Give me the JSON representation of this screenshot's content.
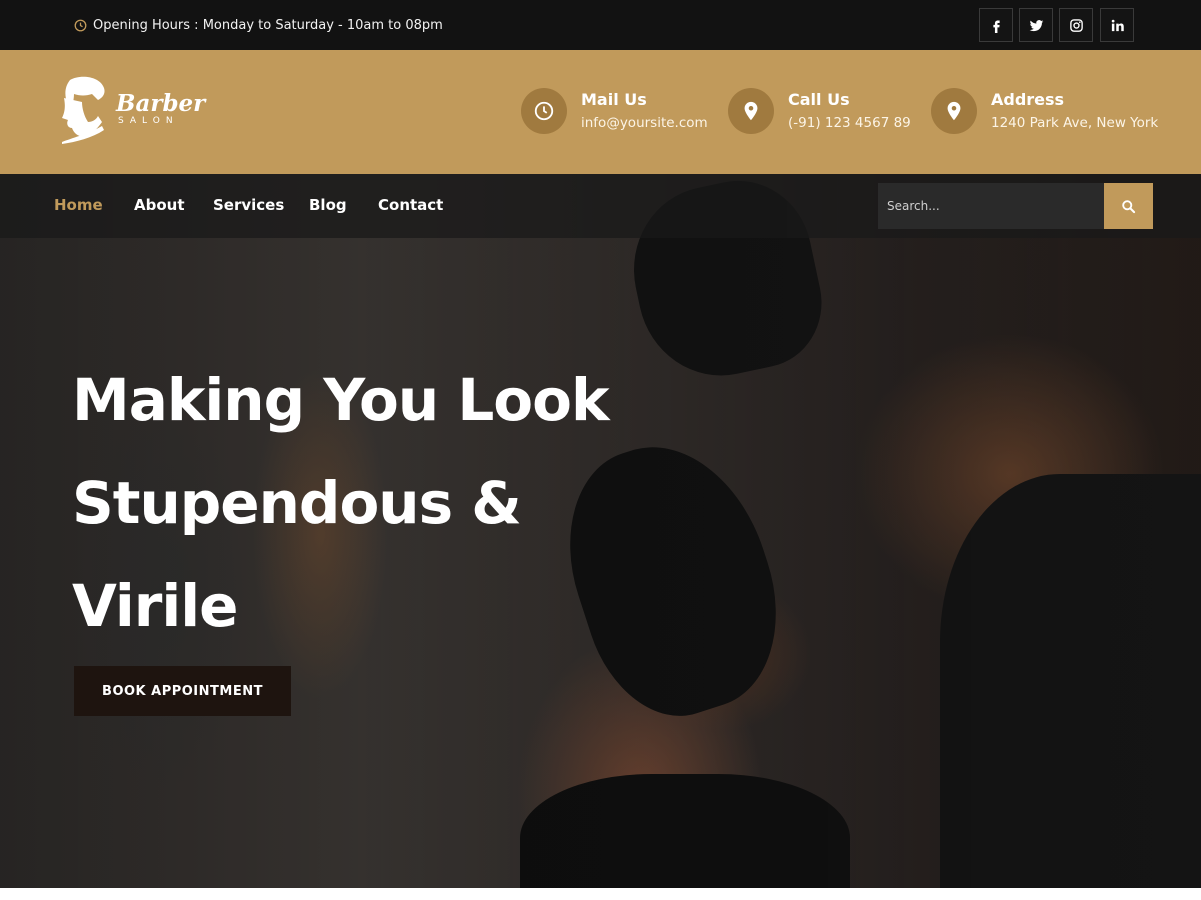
{
  "topbar": {
    "hours": "Opening Hours : Monday to Saturday - 10am to 08pm",
    "social": [
      "facebook-icon",
      "twitter-icon",
      "instagram-icon",
      "linkedin-icon"
    ]
  },
  "logo": {
    "brand": "Barber",
    "sub": "SALON"
  },
  "contacts": {
    "mail": {
      "title": "Mail Us",
      "value": "info@yoursite.com",
      "icon": "clock-icon"
    },
    "call": {
      "title": "Call Us",
      "value": "(-91) 123 4567 89",
      "icon": "location-pin-icon"
    },
    "address": {
      "title": "Address",
      "value": "1240 Park Ave, New York",
      "icon": "location-pin-icon"
    }
  },
  "nav": {
    "items": [
      {
        "label": "Home",
        "active": true
      },
      {
        "label": "About"
      },
      {
        "label": "Services"
      },
      {
        "label": "Blog"
      },
      {
        "label": "Contact"
      }
    ],
    "search_placeholder": "Search..."
  },
  "hero": {
    "line1": "Making You Look",
    "line2": "Stupendous &",
    "line3": "Virile",
    "cta": "BOOK APPOINTMENT"
  },
  "colors": {
    "accent": "#c19a5b",
    "topbar": "#121212",
    "button_dark": "#1e140f"
  }
}
